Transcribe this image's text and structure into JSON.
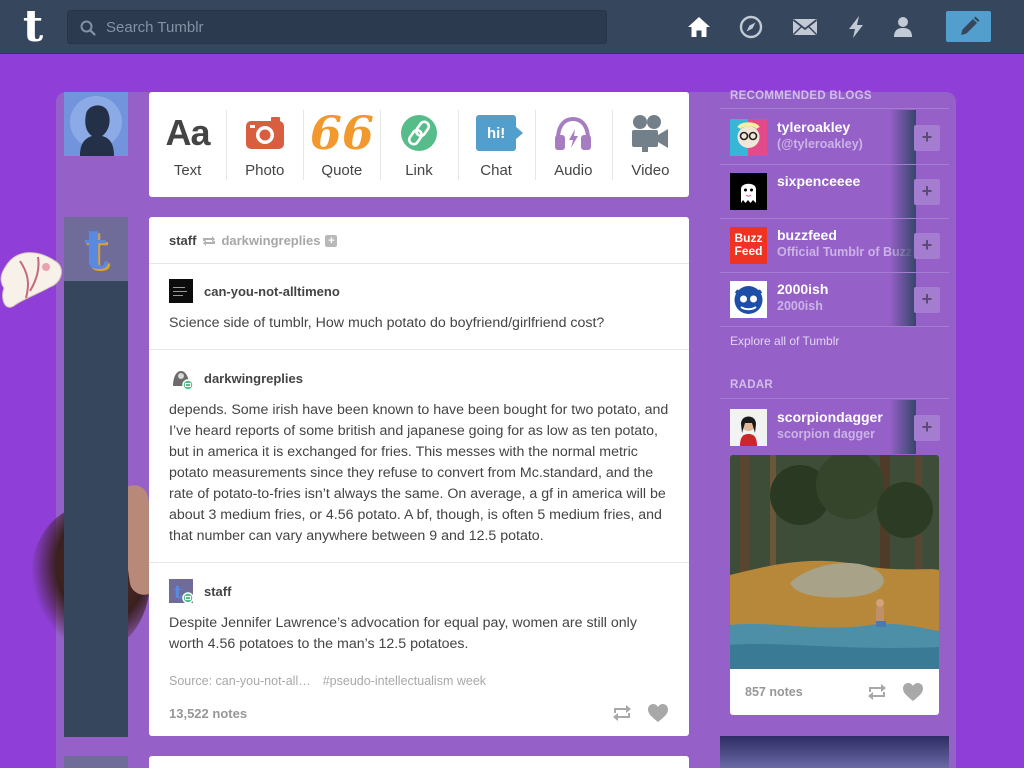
{
  "topbar": {
    "logo": "t",
    "search_placeholder": "Search Tumblr",
    "nav": [
      "home-icon",
      "explore-compass-icon",
      "inbox-mail-icon",
      "activity-lightning-icon",
      "account-person-icon"
    ],
    "compose_icon": "pencil-icon"
  },
  "post_types": [
    {
      "label": "Text",
      "icon": "Aa",
      "color": "#444444"
    },
    {
      "label": "Photo",
      "icon": "camera-icon",
      "color": "#d95e40"
    },
    {
      "label": "Quote",
      "icon": "66",
      "color": "#f2992e"
    },
    {
      "label": "Link",
      "icon": "link-icon",
      "color": "#56bc8a"
    },
    {
      "label": "Chat",
      "icon": "hi!",
      "color": "#529ecc"
    },
    {
      "label": "Audio",
      "icon": "headphones-icon",
      "color": "#a77dc2"
    },
    {
      "label": "Video",
      "icon": "video-camera-icon",
      "color": "#748089"
    }
  ],
  "post": {
    "author": "staff",
    "reblogged_from": "darkwingreplies",
    "trail": [
      {
        "user": "can-you-not-alltimeno",
        "body": "Science side of tumblr, How much potato do boyfriend/girlfriend cost?"
      },
      {
        "user": "darkwingreplies",
        "body": "depends. Some irish have been known to have been bought for two potato, and I’ve heard reports of some british and japanese going for as low as ten potato, but in america it is exchanged for fries. This messes with the normal metric potato measurements since they refuse to convert from Mc.standard, and the rate of potato-to-fries isn’t always the same. On average, a gf in america will be about 3 medium fries, or 4.56 potato. A bf, though, is often 5 medium fries, and that number can vary anywhere between 9 and 12.5 potato."
      },
      {
        "user": "staff",
        "body": "Despite Jennifer Lawrence’s advocation for equal pay, women are still only worth 4.56 potatoes to the man’s 12.5 potatoes."
      }
    ],
    "source": "Source: can-you-not-all…",
    "tag": "#pseudo-intellectualism week",
    "notes": "13,522 notes"
  },
  "sidebar": {
    "recommended_title": "RECOMMENDED BLOGS",
    "blogs": [
      {
        "name": "tyleroakley",
        "sub": "(@tyleroakley)"
      },
      {
        "name": "sixpenceeee",
        "sub": ""
      },
      {
        "name": "buzzfeed",
        "sub": "Official Tumblr of BuzzFeed"
      },
      {
        "name": "2000ish",
        "sub": "2000ish"
      }
    ],
    "explore_link": "Explore all of Tumblr",
    "radar_title": "RADAR",
    "radar": {
      "name": "scorpiondagger",
      "sub": "scorpion dagger",
      "notes": "857 notes"
    },
    "plus_label": "+",
    "buzzfeed_logo": [
      "Buzz",
      "Feed"
    ]
  },
  "colors": {
    "accent": "#529ecc",
    "background": "#8f3fd8",
    "topbar": "#36465d"
  }
}
